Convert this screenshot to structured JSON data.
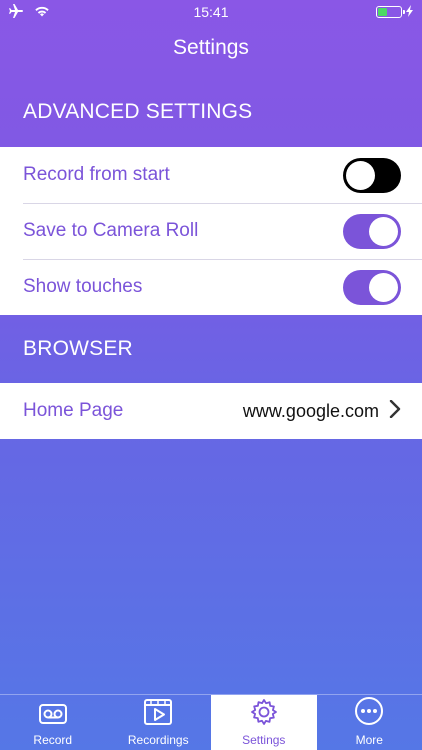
{
  "status_bar": {
    "time": "15:41",
    "left_icons": [
      "airplane-icon",
      "wifi-icon"
    ],
    "battery_level": 0.4,
    "charging": true
  },
  "nav": {
    "title": "Settings"
  },
  "sections": {
    "advanced": {
      "header": "ADVANCED SETTINGS",
      "rows": [
        {
          "label": "Record from start",
          "toggle": false
        },
        {
          "label": "Save to Camera Roll",
          "toggle": true
        },
        {
          "label": "Show touches",
          "toggle": true
        }
      ]
    },
    "browser": {
      "header": "BROWSER",
      "rows": [
        {
          "label": "Home Page",
          "value": "www.google.com"
        }
      ]
    }
  },
  "tabs": [
    {
      "label": "Record",
      "icon": "cassette-icon",
      "active": false
    },
    {
      "label": "Recordings",
      "icon": "film-play-icon",
      "active": false
    },
    {
      "label": "Settings",
      "icon": "gear-icon",
      "active": true
    },
    {
      "label": "More",
      "icon": "more-dots-icon",
      "active": false
    }
  ],
  "colors": {
    "accent": "#7b54d9",
    "gradient_top": "#8a57e6",
    "gradient_bottom": "#5577e6",
    "toggle_off": "#000000",
    "battery": "#4cd964"
  }
}
